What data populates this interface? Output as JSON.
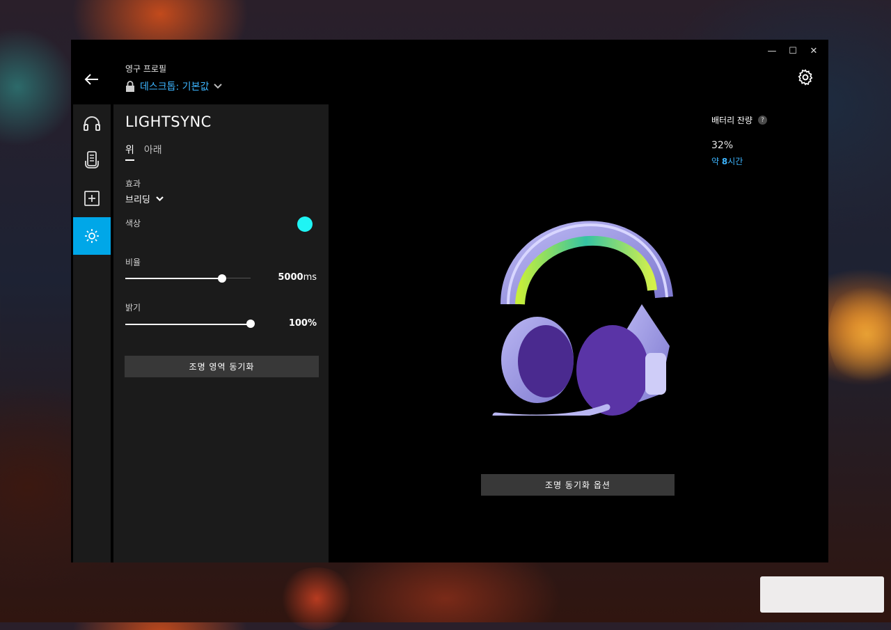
{
  "window": {
    "controls": {
      "minimize": "—",
      "maximize": "☐",
      "close": "✕"
    }
  },
  "header": {
    "profile_label": "영구 프로필",
    "profile_value": "데스크톱: 기본값"
  },
  "sidebar": {
    "items": [
      {
        "icon": "headphones-icon"
      },
      {
        "icon": "device-settings-icon"
      },
      {
        "icon": "add-square-icon"
      },
      {
        "icon": "lighting-sun-icon",
        "active": true
      }
    ]
  },
  "panel": {
    "title": "LIGHTSYNC",
    "tabs": [
      {
        "label": "위",
        "active": true
      },
      {
        "label": "아래",
        "active": false
      }
    ],
    "effect_label": "효과",
    "effect_value": "브리딩",
    "color_label": "색상",
    "color_value": "#1ff4f4",
    "rate_label": "비율",
    "rate_value": "5000",
    "rate_unit": "ms",
    "rate_fraction": 0.77,
    "brightness_label": "밝기",
    "brightness_value": "100%",
    "brightness_fraction": 1.0,
    "sync_zones_button": "조명 영역 동기화"
  },
  "main": {
    "battery_label": "배터리 잔량",
    "battery_help": "?",
    "battery_percent": "32%",
    "battery_time_prefix": "약 ",
    "battery_time_hours": "8",
    "battery_time_suffix": "시간",
    "sync_options_button": "조명 동기화 옵션"
  },
  "colors": {
    "accent": "#00a7e8",
    "link": "#3db5ff",
    "panel_bg": "#1b1b1b",
    "window_bg": "#000000"
  }
}
